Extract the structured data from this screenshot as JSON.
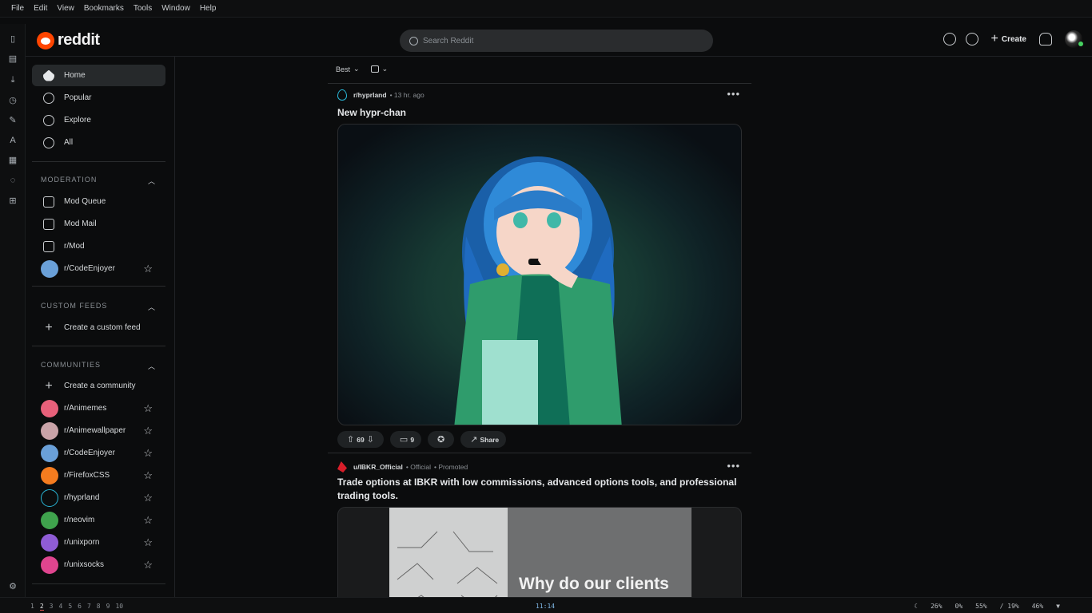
{
  "menubar": [
    "File",
    "Edit",
    "View",
    "Bookmarks",
    "Tools",
    "Window",
    "Help"
  ],
  "sidestrip_icons": [
    "bookmark-icon",
    "reader-icon",
    "download-icon",
    "history-icon",
    "notes-icon",
    "translate-icon",
    "calendar-icon",
    "chat-icon",
    "add-panel-icon",
    "settings-icon"
  ],
  "header": {
    "logo_text": "reddit",
    "search_placeholder": "Search Reddit",
    "create_label": "Create"
  },
  "sidebar": {
    "nav": [
      "Home",
      "Popular",
      "Explore",
      "All"
    ],
    "moderation_title": "MODERATION",
    "moderation_items": [
      "Mod Queue",
      "Mod Mail",
      "r/Mod",
      "r/CodeEnjoyer"
    ],
    "custom_feeds_title": "CUSTOM FEEDS",
    "create_custom_feed": "Create a custom feed",
    "communities_title": "COMMUNITIES",
    "create_community": "Create a community",
    "communities": [
      "r/Animemes",
      "r/Animewallpaper",
      "r/CodeEnjoyer",
      "r/FirefoxCSS",
      "r/hyprland",
      "r/neovim",
      "r/unixporn",
      "r/unixsocks"
    ],
    "community_colors": [
      "#e8607a",
      "#c9a3a8",
      "#6aa0d8",
      "#f57c1f",
      "#29b6d6",
      "#3fa34d",
      "#8f5cd6",
      "#e0458f"
    ]
  },
  "feed": {
    "sort_label": "Best",
    "post1": {
      "subreddit": "r/hyprland",
      "time": "• 13 hr. ago",
      "title": "New hypr-chan",
      "votes": "69",
      "comments": "9",
      "share": "Share"
    },
    "post2": {
      "author": "u/IBKR_Official",
      "official": "• Official",
      "promoted": "• Promoted",
      "title": "Trade options at IBKR with low commissions, advanced options tools, and professional trading tools.",
      "image_text": "Why do our clients"
    }
  },
  "statusbar": {
    "workspaces": [
      "1",
      "2",
      "3",
      "4",
      "5",
      "6",
      "7",
      "8",
      "9",
      "10"
    ],
    "current_workspace": "2",
    "clock": "11:14",
    "cpu": "26%",
    "volume": "0%",
    "memory": "55%",
    "disk": "/ 19%",
    "battery": "46%"
  }
}
